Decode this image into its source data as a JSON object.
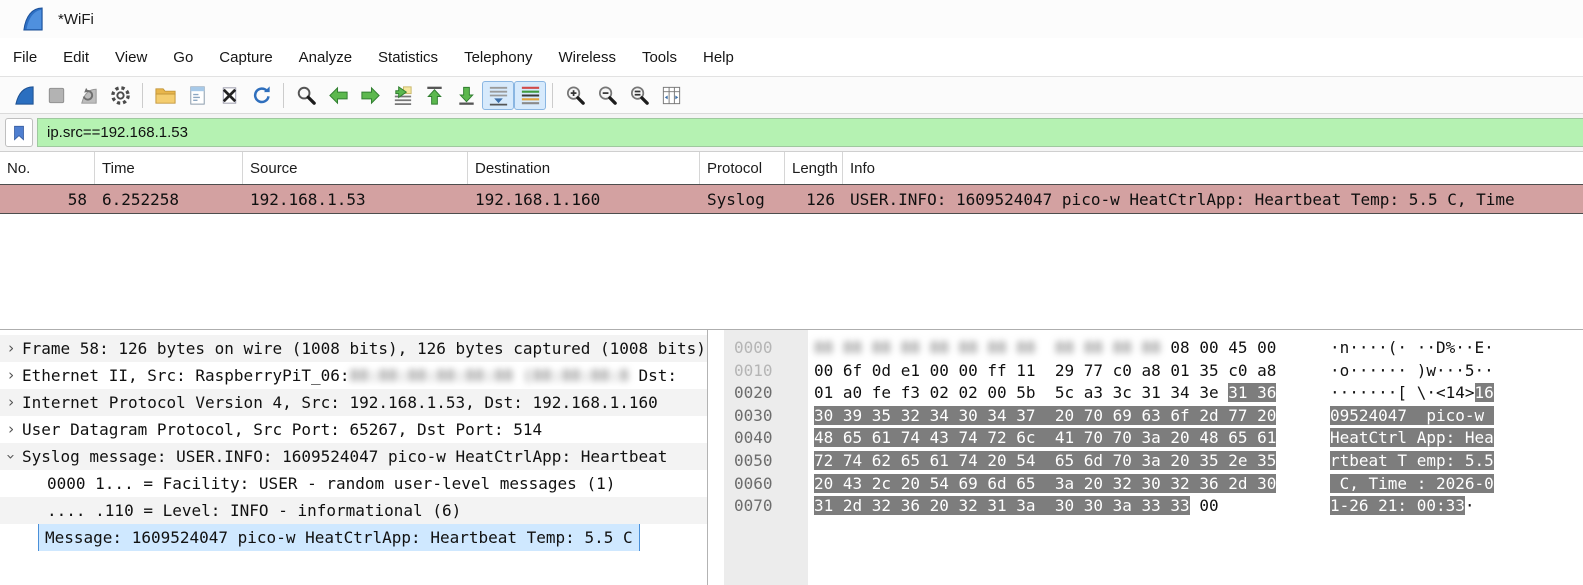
{
  "window": {
    "title": "*WiFi"
  },
  "menu": {
    "items": [
      "File",
      "Edit",
      "View",
      "Go",
      "Capture",
      "Analyze",
      "Statistics",
      "Telephony",
      "Wireless",
      "Tools",
      "Help"
    ]
  },
  "toolbar": {
    "groups": [
      [
        "start-capture",
        "stop-capture",
        "restart-capture",
        "capture-options"
      ],
      [
        "open-file",
        "save-file",
        "close-file",
        "reload-file"
      ],
      [
        "find-packet",
        "go-back",
        "go-forward",
        "go-to-packet",
        "go-first-packet",
        "go-last-packet",
        "auto-scroll",
        "colorize"
      ],
      [
        "zoom-in",
        "zoom-out",
        "zoom-original",
        "resize-columns"
      ]
    ],
    "active": [
      "auto-scroll",
      "colorize"
    ]
  },
  "filter": {
    "value": "ip.src==192.168.1.53",
    "bg": "#b5f2b2"
  },
  "packet_list": {
    "columns": [
      "No.",
      "Time",
      "Source",
      "Destination",
      "Protocol",
      "Length",
      "Info"
    ],
    "rows": [
      {
        "no": "58",
        "time": "6.252258",
        "source": "192.168.1.53",
        "destination": "192.168.1.160",
        "protocol": "Syslog",
        "length": "126",
        "info": "USER.INFO: 1609524047 pico-w HeatCtrlApp: Heartbeat Temp: 5.5 C, Time",
        "row_color": "#d3a1a1"
      }
    ]
  },
  "details": {
    "rows": [
      {
        "expander": "collapsed",
        "segments": [
          {
            "t": "Frame 58: 126 bytes on wire (1008 bits), 126 bytes captured (1008 bits)"
          }
        ]
      },
      {
        "expander": "collapsed",
        "segments": [
          {
            "t": "Ethernet II, Src: RaspberryPiT_06:"
          },
          {
            "blur": true,
            "ch": 30
          },
          {
            "t": " Dst:"
          }
        ]
      },
      {
        "expander": "collapsed",
        "segments": [
          {
            "t": "Internet Protocol Version 4, Src: 192.168.1.53, Dst: 192.168.1.160"
          }
        ]
      },
      {
        "expander": "collapsed",
        "segments": [
          {
            "t": "User Datagram Protocol, Src Port: 65267, Dst Port: 514"
          }
        ]
      },
      {
        "expander": "expanded",
        "segments": [
          {
            "t": "Syslog message: USER.INFO: 1609524047 pico-w HeatCtrlApp: Heartbeat"
          }
        ]
      },
      {
        "expander": "none",
        "indent": 1,
        "segments": [
          {
            "t": "0000 1... = Facility: USER - random user-level messages (1)"
          }
        ]
      },
      {
        "expander": "none",
        "indent": 1,
        "segments": [
          {
            "t": ".... .110 = Level: INFO - informational (6)"
          }
        ]
      },
      {
        "expander": "none",
        "indent": 1,
        "selected": true,
        "segments": [
          {
            "t": "Message: 1609524047 pico-w HeatCtrlApp: Heartbeat Temp: 5.5 C"
          }
        ]
      }
    ]
  },
  "hex_dump": {
    "rows": [
      {
        "offset": "0000",
        "dim": true,
        "hex": [
          {
            "blur": true,
            "pairs": 12
          },
          {
            "t": " 08 00 45 00"
          }
        ],
        "ascii": [
          {
            "t": "·n····(· ··D%··E·"
          }
        ]
      },
      {
        "offset": "0010",
        "dim": true,
        "hex": [
          {
            "t": "00 6f 0d e1 00 00 ff 11  29 77 c0 a8 01 35 c0 a8"
          }
        ],
        "ascii": [
          {
            "t": "·o······ )w···5··"
          }
        ]
      },
      {
        "offset": "0020",
        "hex": [
          {
            "t": "01 a0 fe f3 02 02 00 5b  5c a3 3c 31 34 3e "
          },
          {
            "t": "31 36",
            "hl": true
          }
        ],
        "ascii": [
          {
            "t": "·······[ \\·<14>"
          },
          {
            "t": "16",
            "hl": true
          }
        ]
      },
      {
        "offset": "0030",
        "hex": [
          {
            "t": "30 39 35 32 34 30 34 37  20 70 69 63 6f 2d 77 20",
            "hl": true
          }
        ],
        "ascii": [
          {
            "t": "09524047  pico-w ",
            "hl": true
          }
        ]
      },
      {
        "offset": "0040",
        "hex": [
          {
            "t": "48 65 61 74 43 74 72 6c  41 70 70 3a 20 48 65 61",
            "hl": true
          }
        ],
        "ascii": [
          {
            "t": "HeatCtrl App: Hea",
            "hl": true
          }
        ]
      },
      {
        "offset": "0050",
        "hex": [
          {
            "t": "72 74 62 65 61 74 20 54  65 6d 70 3a 20 35 2e 35",
            "hl": true
          }
        ],
        "ascii": [
          {
            "t": "rtbeat T emp: 5.5",
            "hl": true
          }
        ]
      },
      {
        "offset": "0060",
        "hex": [
          {
            "t": "20 43 2c 20 54 69 6d 65  3a 20 32 30 32 36 2d 30",
            "hl": true
          }
        ],
        "ascii": [
          {
            "t": " C, Time : 2026-0",
            "hl": true
          }
        ]
      },
      {
        "offset": "0070",
        "hex": [
          {
            "t": "31 2d 32 36 20 32 31 3a  30 30 3a 33 33",
            "hl": true
          },
          {
            "t": " 00"
          }
        ],
        "ascii": [
          {
            "t": "1-26 21: 00:33",
            "hl": true
          },
          {
            "t": "·"
          }
        ]
      }
    ]
  },
  "colors": {
    "filter_bg": "#b5f2b2",
    "syslog_row_bg": "#d3a1a1",
    "selected_detail_bg": "#cfe8ff",
    "hex_highlight_bg": "#7d7d7d",
    "active_tool_bg": "#d7eafc"
  }
}
